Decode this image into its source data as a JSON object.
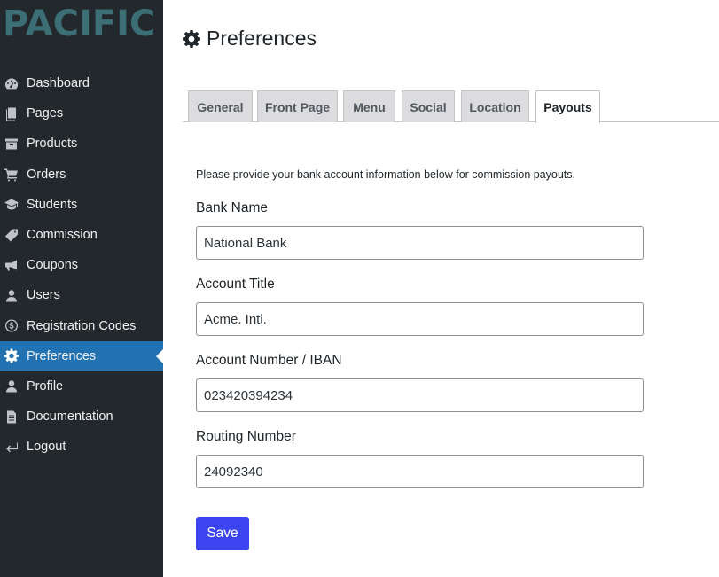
{
  "app": {
    "logo": "PACIFIC"
  },
  "sidebar": {
    "items": [
      {
        "label": "Dashboard",
        "icon": "dashboard-icon"
      },
      {
        "label": "Pages",
        "icon": "pages-icon"
      },
      {
        "label": "Products",
        "icon": "archive-icon"
      },
      {
        "label": "Orders",
        "icon": "cart-icon"
      },
      {
        "label": "Students",
        "icon": "graduation-cap-icon"
      },
      {
        "label": "Commission",
        "icon": "tag-icon"
      },
      {
        "label": "Coupons",
        "icon": "megaphone-icon"
      },
      {
        "label": "Users",
        "icon": "user-icon"
      },
      {
        "label": "Registration Codes",
        "icon": "dollar-circle-icon"
      },
      {
        "label": "Preferences",
        "icon": "gear-icon",
        "active": true
      },
      {
        "label": "Profile",
        "icon": "user-icon"
      },
      {
        "label": "Documentation",
        "icon": "document-icon"
      },
      {
        "label": "Logout",
        "icon": "logout-arrow-icon"
      }
    ]
  },
  "header": {
    "title": "Preferences",
    "icon": "gear-icon"
  },
  "tabs": [
    {
      "label": "General"
    },
    {
      "label": "Front Page"
    },
    {
      "label": "Menu"
    },
    {
      "label": "Social"
    },
    {
      "label": "Location"
    },
    {
      "label": "Payouts",
      "active": true
    }
  ],
  "form": {
    "intro": "Please provide your bank account information below for commission payouts.",
    "fields": [
      {
        "label": "Bank Name",
        "value": "National Bank"
      },
      {
        "label": "Account Title",
        "value": "Acme. Intl."
      },
      {
        "label": "Account Number / IBAN",
        "value": "023420394234"
      },
      {
        "label": "Routing Number",
        "value": "24092340"
      }
    ],
    "save_label": "Save"
  },
  "colors": {
    "sidebar_bg": "#23282d",
    "active_item": "#2271b1",
    "logo": "#3c6e75",
    "save_button": "#3c44f0"
  }
}
